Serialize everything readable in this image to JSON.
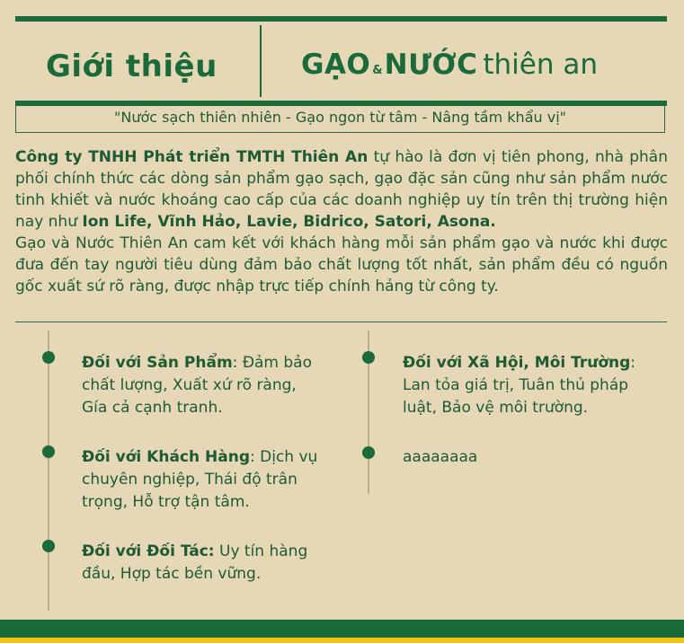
{
  "header": {
    "title": "Giới thiệu",
    "logo": {
      "part1": "GẠO",
      "amp": "&",
      "part2": "NƯỚC",
      "part3": "thiên an"
    }
  },
  "slogan": "\"Nước sạch thiên nhiên - Gạo ngon từ tâm - Nâng tầm khẩu vị\"",
  "intro": {
    "company": "Công ty TNHH Phát triển TMTH Thiên An",
    "p1a": " tự hào là đơn vị tiên phong, nhà phân phối chính thức các dòng sản phẩm gạo sạch, gạo đặc sản cũng như sản phẩm nước tinh khiết và nước khoáng cao cấp của các doanh nghiệp uy tín trên thị trường hiện nay như ",
    "brands": "Ion Life, Vĩnh Hảo, Lavie, Bidrico, Satori, Asona.",
    "p2": "Gạo và Nước Thiên An cam kết với khách hàng mỗi sản phẩm gạo và nước khi được đưa đến tay người tiêu dùng đảm bảo chất lượng tốt nhất, sản phẩm đều có nguồn gốc xuất sứ rõ ràng, được nhập trực tiếp chính hảng từ công ty."
  },
  "commitments": {
    "left": [
      {
        "heading": "Đối với Sản Phẩm",
        "sep": ": ",
        "text": "Đảm bảo chất lượng, Xuất xứ rõ ràng, Gía cả cạnh tranh."
      },
      {
        "heading": "Đối với Khách Hàng",
        "sep": ": ",
        "text": "Dịch vụ chuyên nghiệp, Thái độ trân trọng, Hỗ trợ tận tâm."
      },
      {
        "heading": "Đối với Đối Tác:",
        "sep": " ",
        "text": "Uy tín hàng đầu, Hợp tác bền vững."
      }
    ],
    "right": [
      {
        "heading": "Đối với Xã Hội, Môi Trường",
        "sep": ": ",
        "text": "Lan tỏa giá trị, Tuân thủ pháp luật, Bảo vệ môi trường."
      },
      {
        "heading": "",
        "sep": "",
        "text": "aaaaaaaa"
      }
    ]
  },
  "colors": {
    "background": "#e6d8b7",
    "accent": "#1b6a3a",
    "text": "#1e5a34",
    "footer_stripe": "#f1c40f"
  }
}
